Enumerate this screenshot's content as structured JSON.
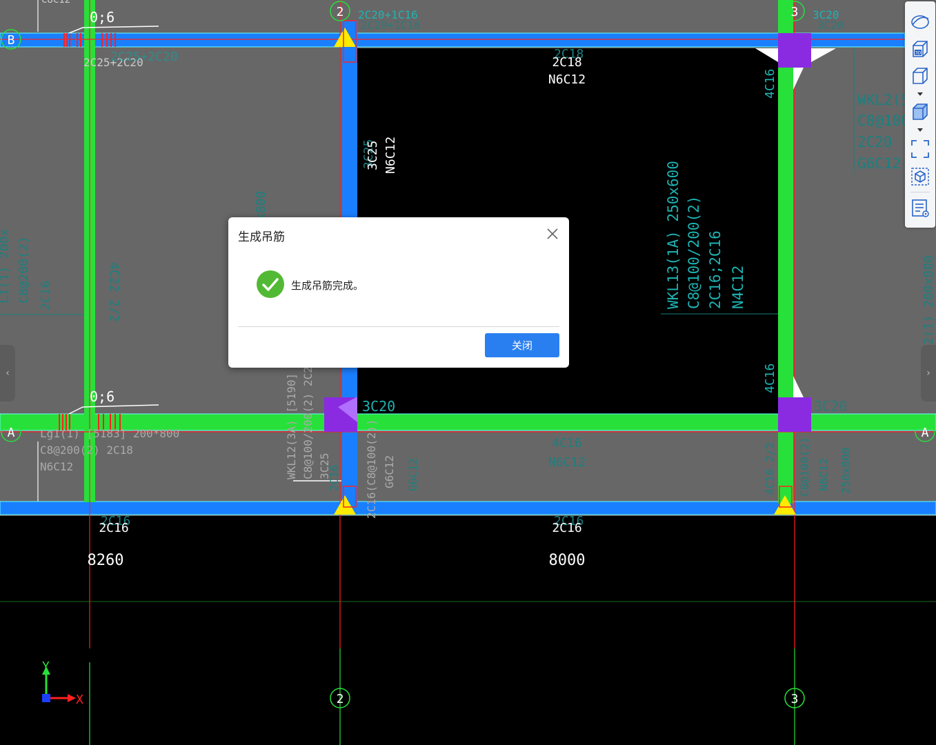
{
  "dialog": {
    "title": "生成吊筋",
    "message": "生成吊筋完成。",
    "close_button": "关闭"
  },
  "axes": {
    "grid_b": "B",
    "grid_a": "A",
    "grid_2": "2",
    "grid_3": "3",
    "dim_1": "8260",
    "dim_2": "8000",
    "axis_x": "X",
    "axis_y": "Y"
  },
  "labels": {
    "zero6_top": "0;6",
    "zero6_bottom": "0;6",
    "b_left_rebar": "2C25+2C20",
    "b_left_rebar_ghost": "2C25+2C20",
    "top_left_ghost": "C8C12",
    "grid2_top": "2C20+1C16",
    "grid2_top_ghost": "2C20+1C16",
    "grid3_top": "3C20",
    "grid3_top_ghost": "3C20",
    "mid_top_1": "2C18",
    "mid_top_2": "N6C12",
    "mid_top_ghost": "2C18",
    "vert_3c25": "3C25",
    "vert_n6c12": "N6C12",
    "vert_3c25_ghost": "3C25",
    "col3_4c16_top": "4C16",
    "col3_4c16_mid": "4C16",
    "wkl13_1": "WKL13(1A) 250x600",
    "wkl13_2": "C8@100/200(2)",
    "wkl13_3": "2C16;2C16",
    "wkl13_4": "N4C12",
    "wkl2_1": "WKL2(5",
    "wkl2_2": "C8@100/",
    "wkl2_3": "2C20",
    "wkl2_4": "G6C12",
    "grid_a_3c20": "3C20",
    "grid_a_3c20_right": "3C20",
    "lg1_1": "Lg1(1) [5183] 200*800",
    "lg1_2": "C8@200(2) 2C18",
    "lg1_3": "N6C12",
    "wkl12_1": "WKL12(3A) [5190] 2",
    "wkl12_2": "C8@100/200(2) 2C2",
    "wkl12_3": "3C25",
    "wkl12_4": "2C16(C8@100(2))",
    "wkl12_5": "G6C12",
    "mid_bottom_ghost_1": "4C16",
    "mid_bottom_ghost_2": "N6C12",
    "bottom_2c16_left": "2C16",
    "bottom_2c16_left_ghost": "2C16",
    "bottom_2c16_mid": "2C16",
    "bottom_2c16_mid_ghost": "2C16",
    "left_vert_ghost_1": "4C22 2/2",
    "left_vert_ghost_2": "C8@200(2)",
    "left_vert_ghost_3": "2C16",
    "left_vert_ghost_4": "L1(1) 200x",
    "top_vert_ghost_800": "x800",
    "right_edge_ghost": "2(1) 200x800",
    "col3_bottom_ghost_1": "4C16 2/2",
    "col3_bottom_ghost_2": "C8@100(2)",
    "col3_bottom_ghost_3": "N6C12",
    "col3_bottom_ghost_4": "250x800",
    "col2_bottom_ghost_1": "2C16",
    "col2_bottom_ghost_2": "G6C12"
  },
  "toolbar": {
    "icons": [
      "orbit-icon",
      "3d-view-icon",
      "cube-outline-icon",
      "cube-solid-icon",
      "fullscreen-icon",
      "cube-selection-icon",
      "properties-panel-icon"
    ]
  },
  "colors": {
    "beam_green": "#28e03a",
    "beam_blue": "#1a7fff",
    "column_purple": "#8a2be2",
    "grid_red": "#ff2020",
    "dialog_button": "#2a7ff0"
  }
}
